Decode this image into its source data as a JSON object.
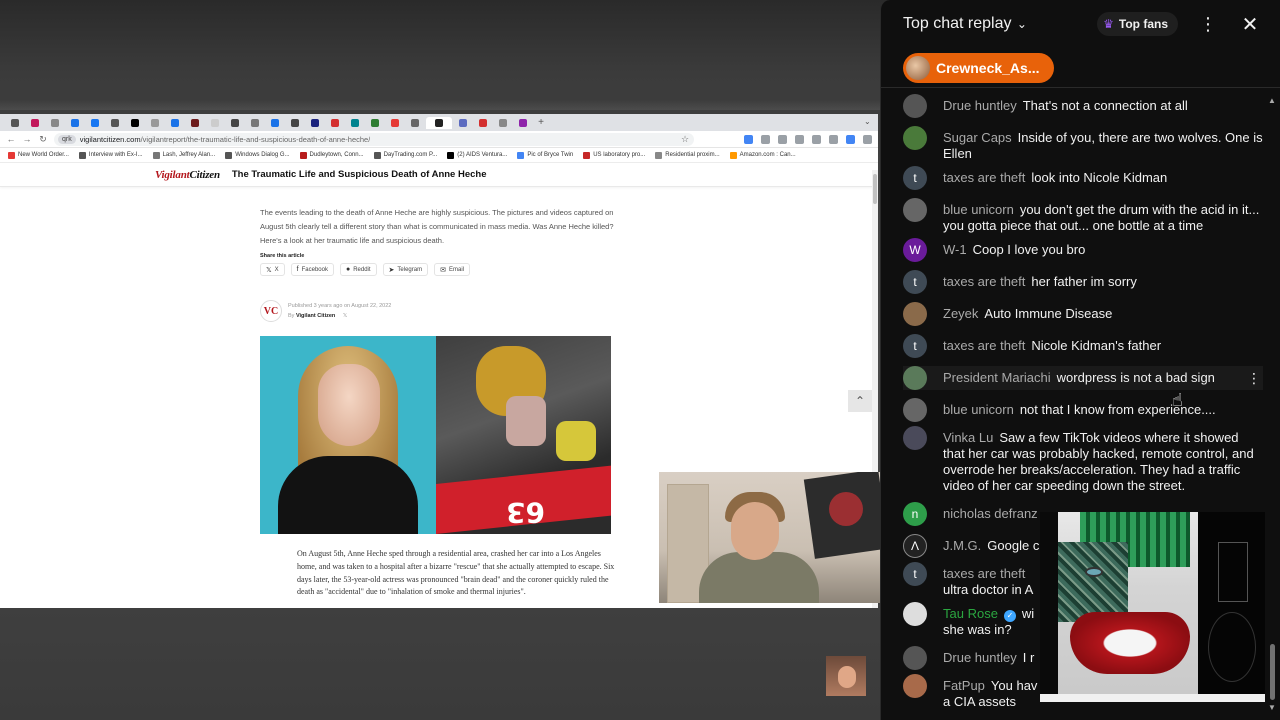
{
  "browser": {
    "url_host": "vigilantcitizen.com",
    "url_path": "/vigilantreport/the-traumatic-life-and-suspicious-death-of-anne-heche/",
    "site_chip": "qrk",
    "bookmarks": [
      "New World Order...",
      "Interview with Ex-I...",
      "Lash, Jeffrey Alan...",
      "Windows Dialog G...",
      "Dudleytown, Conn...",
      "DayTrading.com P...",
      "(2) AIDS Ventura...",
      "Pic of Bryce Twin",
      "US laboratory pro...",
      "Residential proxim...",
      "Amazon.com : Can..."
    ]
  },
  "site": {
    "logo": "VigilantCitizen",
    "logo_main": "Vigilant",
    "logo_sub": "Citizen",
    "header_title": "The Traumatic Life and Suspicious Death of Anne Heche",
    "intro": "The events leading to the death of Anne Heche are highly suspicious. The pictures and videos captured on August 5th clearly tell a different story than what is communicated in mass media. Was Anne Heche killed? Here's a look at her traumatic life and suspicious death.",
    "share_label": "Share this article",
    "share_buttons": [
      {
        "icon": "x-icon",
        "glyph": "𝕏",
        "label": "X"
      },
      {
        "icon": "facebook-icon",
        "glyph": "f",
        "label": "Facebook"
      },
      {
        "icon": "reddit-icon",
        "glyph": "●",
        "label": "Reddit"
      },
      {
        "icon": "telegram-icon",
        "glyph": "➤",
        "label": "Telegram"
      },
      {
        "icon": "email-icon",
        "glyph": "✉",
        "label": "Email"
      }
    ],
    "vc_badge": "VC",
    "published_line": "Published 3 years ago on August 22, 2022",
    "by_prefix": "By",
    "author": "Vigilant Citizen",
    "car_number": "63",
    "body_text": "On August 5th, Anne Heche sped through a residential area, crashed her car into a Los Angeles home, and was taken to a hospital after a bizarre \"rescue\" that she actually attempted to escape. Six days later, the 53-year-old actress was pronounced \"brain dead\" and the coroner quickly ruled the death as \"accidental\" due to \"inhalation of smoke and thermal injuries\"."
  },
  "chat": {
    "title": "Top chat replay",
    "top_fans_label": "Top fans",
    "pinned_user": "Crewneck_As...",
    "messages": [
      {
        "author": "Drue huntley",
        "text": "That's not a connection at all",
        "avatar_color": "#555555",
        "avatar_letter": ""
      },
      {
        "author": "Sugar Caps",
        "text": "Inside of you, there are two wolves. One is Ellen",
        "avatar_color": "#4a7a3a",
        "avatar_letter": ""
      },
      {
        "author": "taxes are theft",
        "text": "look into Nicole Kidman",
        "avatar_color": "#3f4a55",
        "avatar_letter": "t"
      },
      {
        "author": "blue unicorn",
        "text": "you don't get the drum with the acid in it... you gotta piece that out... one bottle at a time",
        "avatar_color": "#666666",
        "avatar_letter": ""
      },
      {
        "author": "W-1",
        "text": "Coop I love you bro",
        "avatar_color": "#6a1b9a",
        "avatar_letter": "W"
      },
      {
        "author": "taxes are theft",
        "text": "her father im sorry",
        "avatar_color": "#3f4a55",
        "avatar_letter": "t"
      },
      {
        "author": "Zeyek",
        "text": "Auto Immune Disease",
        "avatar_color": "#8a6a4a",
        "avatar_letter": ""
      },
      {
        "author": "taxes are theft",
        "text": "Nicole Kidman's father",
        "avatar_color": "#3f4a55",
        "avatar_letter": "t"
      },
      {
        "author": "President Mariachi",
        "text": "wordpress is not a bad sign",
        "avatar_color": "#5a7a5a",
        "avatar_letter": ""
      },
      {
        "author": "blue unicorn",
        "text": "not that I know from experience....",
        "avatar_color": "#666666",
        "avatar_letter": ""
      },
      {
        "author": "Vinka Lu",
        "text": "Saw a few TikTok videos where it showed that her car was probably hacked, remote control, and overrode her breaks/acceleration. They had a traffic video of her car speeding down the street.",
        "avatar_color": "#4a4a5a",
        "avatar_letter": ""
      },
      {
        "author": "nicholas defranz",
        "text": "",
        "avatar_color": "#2e9e4a",
        "avatar_letter": "n"
      },
      {
        "author": "J.M.G.",
        "text": "Google c",
        "avatar_color": "#222222",
        "avatar_letter": "Λ"
      },
      {
        "author": "taxes are theft",
        "text": "ultra doctor in A",
        "avatar_color": "#3f4a55",
        "avatar_letter": "t"
      },
      {
        "author": "Tau Rose",
        "text": "she was in?",
        "avatar_color": "#dddddd",
        "avatar_letter": "",
        "inline_text": "wi"
      },
      {
        "author": "Drue huntley",
        "text": "I r",
        "avatar_color": "#555555",
        "avatar_letter": ""
      },
      {
        "author": "FatPup",
        "text": "a CIA assets",
        "avatar_color": "#a86a4a",
        "avatar_letter": "",
        "inline_text": "You hav"
      }
    ]
  }
}
